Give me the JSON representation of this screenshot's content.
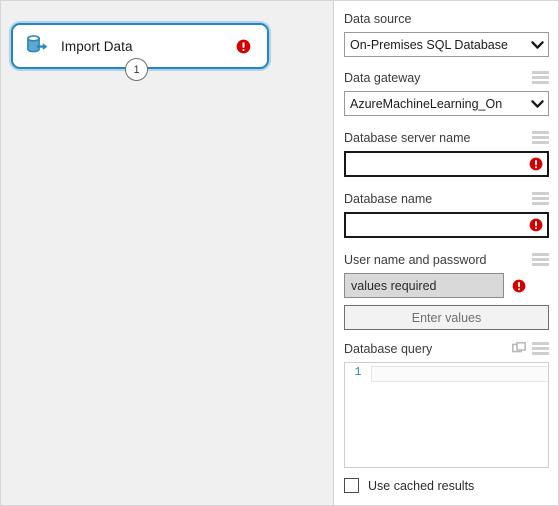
{
  "canvas": {
    "node": {
      "title": "Import Data",
      "icon": "import-data-database-icon",
      "error_icon": "error-icon",
      "badge_number": "1"
    },
    "background_color": "#f0f0f0",
    "node_border_color": "#2086c4"
  },
  "panel": {
    "error_color": "#d40000",
    "fields": [
      {
        "label": "Data source",
        "type": "select",
        "value": "On-Premises SQL Database",
        "has_menu_icon": false,
        "has_error": false
      },
      {
        "label": "Data gateway",
        "type": "select",
        "value": "AzureMachineLearning_On",
        "has_menu_icon": true,
        "has_error": false
      },
      {
        "label": "Database server name",
        "type": "text",
        "value": "",
        "has_menu_icon": true,
        "has_error": true
      },
      {
        "label": "Database name",
        "type": "text",
        "value": "",
        "has_menu_icon": true,
        "has_error": true
      },
      {
        "label": "User name and password",
        "type": "credentials",
        "value": "values required",
        "button_label": "Enter values",
        "has_menu_icon": true,
        "has_error": true
      },
      {
        "label": "Database query",
        "type": "code",
        "line_number": "1",
        "value": "",
        "has_menu_icon": true,
        "has_popout_icon": true,
        "has_error": false
      }
    ],
    "checkbox": {
      "label": "Use cached results",
      "checked": false
    }
  }
}
